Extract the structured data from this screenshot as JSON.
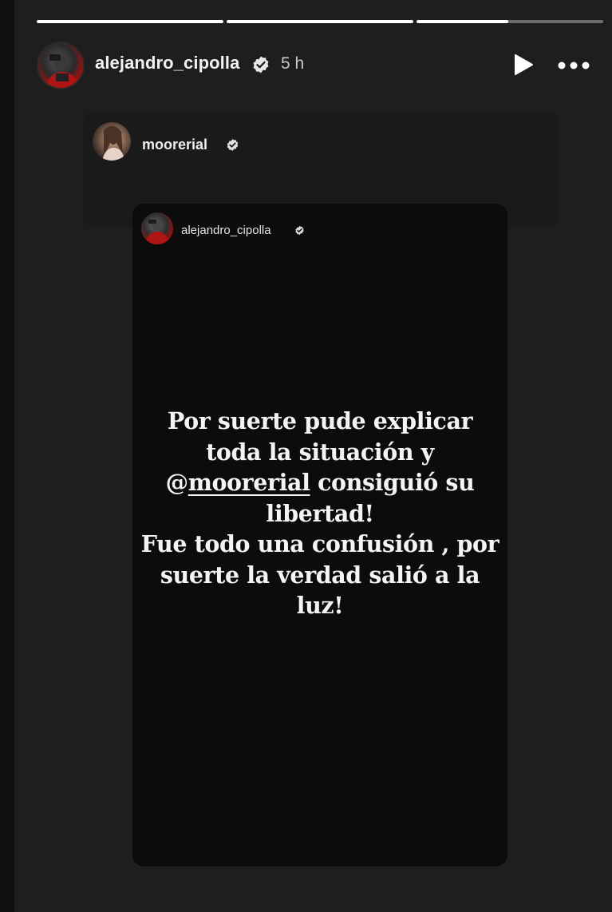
{
  "progress": [
    {
      "fill": 1.0
    },
    {
      "fill": 1.0
    },
    {
      "fill": 0.49
    }
  ],
  "header": {
    "username": "alejandro_cipolla",
    "time": "5 h",
    "play_icon": "play-icon",
    "more_icon": "more-options-icon",
    "verified_icon": "verified-badge-icon"
  },
  "reshare": {
    "username": "moorerial",
    "verified_icon": "verified-badge-icon"
  },
  "inner_story": {
    "username": "alejandro_cipolla",
    "verified_icon": "verified-badge-icon",
    "text": {
      "line1": "Por suerte pude explicar",
      "line2": "toda la situación y",
      "mention_symbol": "@",
      "mention": "moorerial",
      "line3_rest": " consiguió su",
      "line4": "libertad!",
      "line5": "Fue todo una confusión , por",
      "line6": "suerte la verdad salió a la",
      "line7": "luz!"
    }
  },
  "colors": {
    "background": "#1e1e1e",
    "story_bg": "#0c0c0c",
    "text": "#f4f4f4"
  }
}
